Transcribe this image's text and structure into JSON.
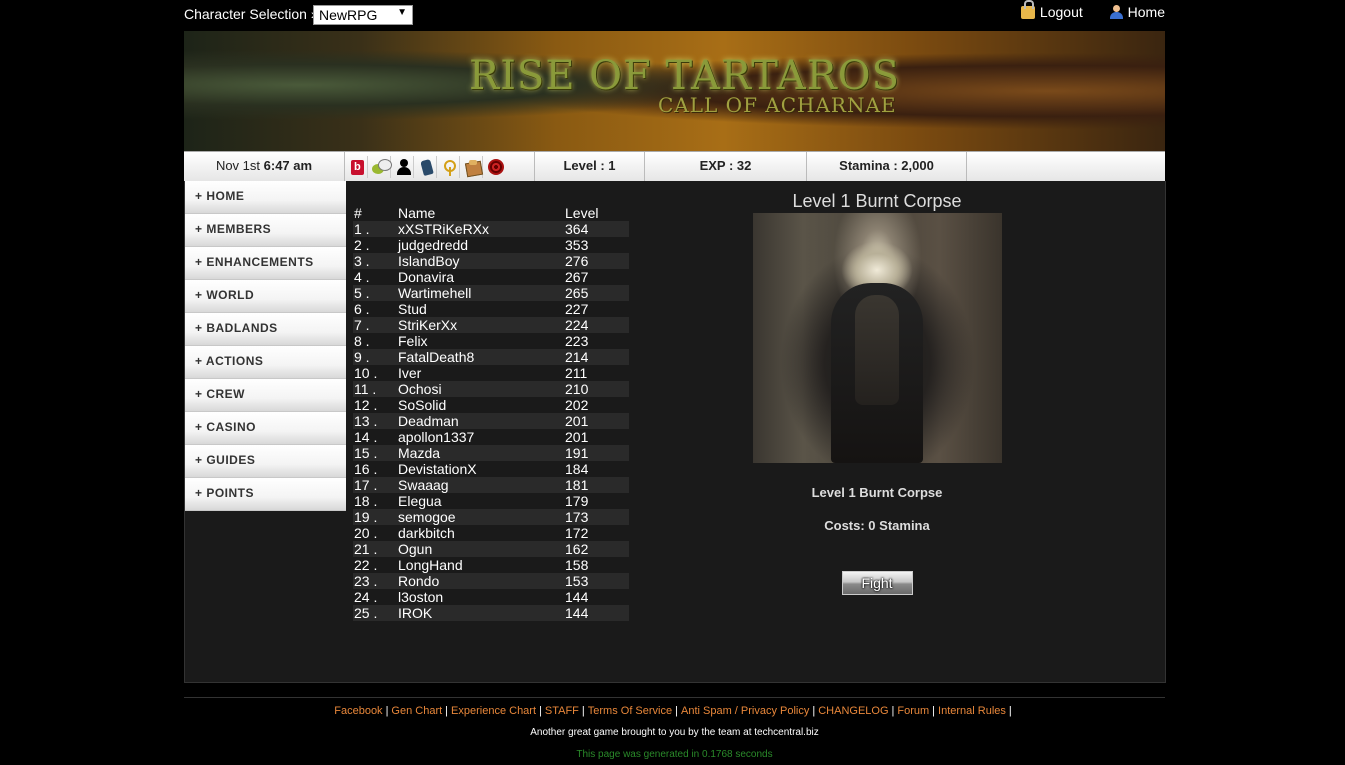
{
  "topbar": {
    "char_selection_label": "Character Selection »",
    "char_selected": "NewRPG",
    "logout_label": "Logout",
    "home_label": "Home"
  },
  "banner": {
    "title": "RISE OF TARTAROS",
    "subtitle": "CALL OF ACHARNAE"
  },
  "status": {
    "date": "Nov 1st",
    "time": "6:47 am",
    "icons": [
      "book-icon",
      "chat-icon",
      "person-icon",
      "bottle-icon",
      "key-icon",
      "box-icon",
      "target-icon"
    ],
    "level": "Level : 1",
    "exp": "EXP : 32",
    "stamina": "Stamina : 2,000"
  },
  "menu": {
    "items": [
      "+ HOME",
      "+ MEMBERS",
      "+ ENHANCEMENTS",
      "+ WORLD",
      "+ BADLANDS",
      "+ ACTIONS",
      "+ CREW",
      "+ CASINO",
      "+ GUIDES",
      "+ POINTS"
    ]
  },
  "ranking": {
    "headers": {
      "num": "#",
      "name": "Name",
      "level": "Level"
    },
    "rows": [
      {
        "num": "1 .",
        "name": "xXSTRiKeRXx",
        "level": "364"
      },
      {
        "num": "2 .",
        "name": "judgedredd",
        "level": "353"
      },
      {
        "num": "3 .",
        "name": "IslandBoy",
        "level": "276"
      },
      {
        "num": "4 .",
        "name": "Donavira",
        "level": "267"
      },
      {
        "num": "5 .",
        "name": "Wartimehell",
        "level": "265"
      },
      {
        "num": "6 .",
        "name": "Stud",
        "level": "227"
      },
      {
        "num": "7 .",
        "name": "StriKerXx",
        "level": "224"
      },
      {
        "num": "8 .",
        "name": "Felix",
        "level": "223"
      },
      {
        "num": "9 .",
        "name": "FatalDeath8",
        "level": "214"
      },
      {
        "num": "10 .",
        "name": "Iver",
        "level": "211"
      },
      {
        "num": "11 .",
        "name": "Ochosi",
        "level": "210"
      },
      {
        "num": "12 .",
        "name": "SoSolid",
        "level": "202"
      },
      {
        "num": "13 .",
        "name": "Deadman",
        "level": "201"
      },
      {
        "num": "14 .",
        "name": "apollon1337",
        "level": "201"
      },
      {
        "num": "15 .",
        "name": "Mazda",
        "level": "191"
      },
      {
        "num": "16 .",
        "name": "DevistationX",
        "level": "184"
      },
      {
        "num": "17 .",
        "name": "Swaaag",
        "level": "181"
      },
      {
        "num": "18 .",
        "name": "Elegua",
        "level": "179"
      },
      {
        "num": "19 .",
        "name": "semogoe",
        "level": "173"
      },
      {
        "num": "20 .",
        "name": "darkbitch",
        "level": "172"
      },
      {
        "num": "21 .",
        "name": "Ogun",
        "level": "162"
      },
      {
        "num": "22 .",
        "name": "LongHand",
        "level": "158"
      },
      {
        "num": "23 .",
        "name": "Rondo",
        "level": "153"
      },
      {
        "num": "24 .",
        "name": "l3oston",
        "level": "144"
      },
      {
        "num": "25 .",
        "name": "IROK",
        "level": "144"
      }
    ]
  },
  "enemy": {
    "title": "Level 1 Burnt Corpse",
    "name": "Level 1 Burnt Corpse",
    "cost": "Costs: 0 Stamina",
    "fight_label": "Fight"
  },
  "footer": {
    "links": [
      "Facebook",
      "Gen Chart",
      "Experience Chart",
      "STAFF",
      "Terms Of Service",
      "Anti Spam / Privacy Policy",
      "CHANGELOG",
      "Forum",
      "Internal Rules"
    ],
    "credit": "Another great game brought to you by the team at techcentral.biz",
    "generated": "This page was generated in 0.1768 seconds"
  },
  "colors": {
    "link": "#e8873a",
    "generated_text": "#2a8a2a",
    "content_bg": "#1a1a1a"
  }
}
